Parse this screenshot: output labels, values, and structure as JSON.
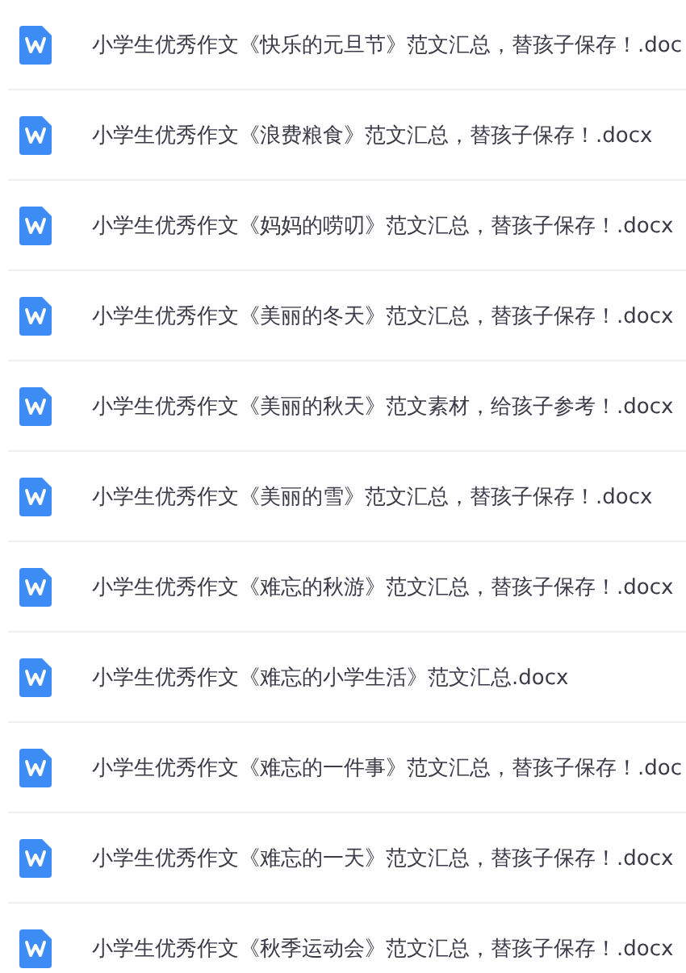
{
  "files": [
    {
      "name": "小学生优秀作文《快乐的元旦节》范文汇总，替孩子保存！.doc"
    },
    {
      "name": "小学生优秀作文《浪费粮食》范文汇总，替孩子保存！.docx"
    },
    {
      "name": "小学生优秀作文《妈妈的唠叨》范文汇总，替孩子保存！.docx"
    },
    {
      "name": "小学生优秀作文《美丽的冬天》范文汇总，替孩子保存！.docx"
    },
    {
      "name": "小学生优秀作文《美丽的秋天》范文素材，给孩子参考！.docx"
    },
    {
      "name": "小学生优秀作文《美丽的雪》范文汇总，替孩子保存！.docx"
    },
    {
      "name": "小学生优秀作文《难忘的秋游》范文汇总，替孩子保存！.docx"
    },
    {
      "name": "小学生优秀作文《难忘的小学生活》范文汇总.docx"
    },
    {
      "name": "小学生优秀作文《难忘的一件事》范文汇总，替孩子保存！.doc"
    },
    {
      "name": "小学生优秀作文《难忘的一天》范文汇总，替孩子保存！.docx"
    },
    {
      "name": "小学生优秀作文《秋季运动会》范文汇总，替孩子保存！.docx"
    }
  ]
}
